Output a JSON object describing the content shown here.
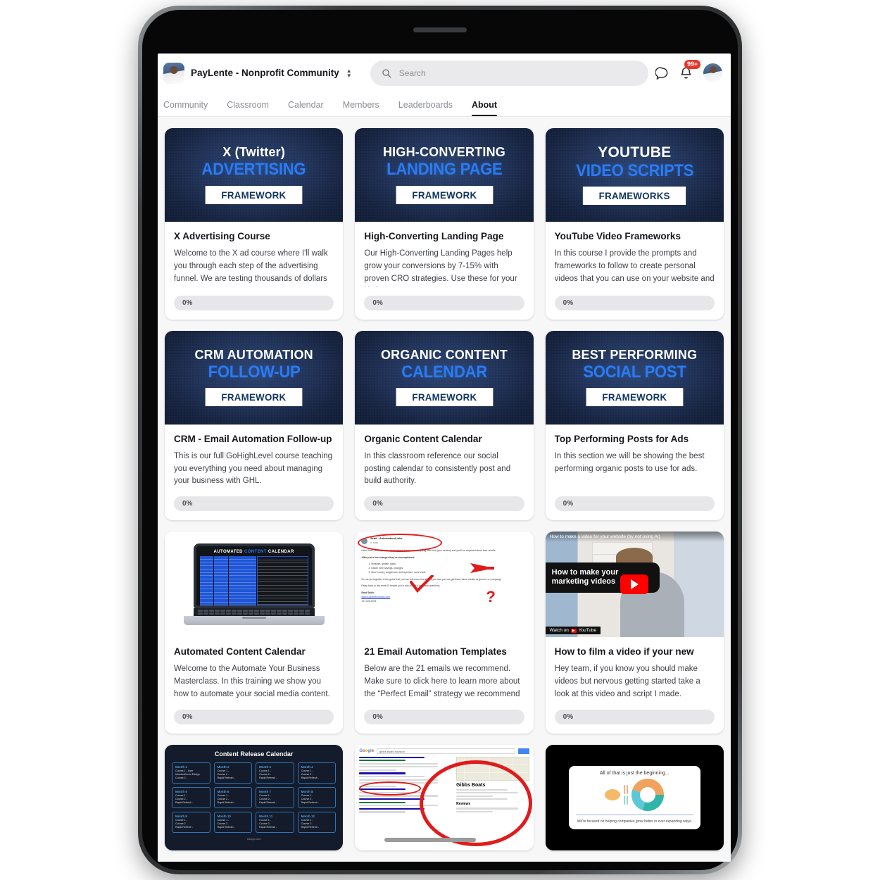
{
  "header": {
    "brand_title": "PayLente - Nonprofit Community",
    "brand_avatar_icon": "user-avatar-image",
    "switcher_icon": "chevron-up-down-icon",
    "search": {
      "icon": "search-icon",
      "placeholder": "Search",
      "value": ""
    },
    "chat_icon": "chat-bubble-icon",
    "bell_icon": "bell-icon",
    "notification_badge": "99+",
    "profile_icon": "profile-avatar"
  },
  "nav": {
    "tabs": [
      {
        "label": "Community",
        "active": false
      },
      {
        "label": "Classroom",
        "active": false
      },
      {
        "label": "Calendar",
        "active": false
      },
      {
        "label": "Members",
        "active": false
      },
      {
        "label": "Leaderboards",
        "active": false
      },
      {
        "label": "About",
        "active": true
      }
    ]
  },
  "courses": {
    "row1": [
      {
        "banner": {
          "line1": "X (Twitter)",
          "line2": "ADVERTISING",
          "chip": "FRAMEWORK"
        },
        "title": "X Advertising Course",
        "description": "Welcome to the X ad course where I'll walk you through each step of the advertising funnel. We are testing thousands of dollars",
        "progress": "0%"
      },
      {
        "banner": {
          "line1": "HIGH-CONVERTING",
          "line2": "LANDING PAGE",
          "chip": "FRAMEWORK"
        },
        "title": "High-Converting Landing Page",
        "description": "Our High-Converting Landing Pages help grow your conversions by 7-15% with proven CRO strategies. Use these for your X shop",
        "progress": "0%"
      },
      {
        "banner": {
          "line1": "YOUTUBE",
          "line2": "VIDEO SCRIPTS",
          "chip": "FRAMEWORKS"
        },
        "title": "YouTube Video Frameworks",
        "description": "In this course I provide the prompts and frameworks to follow to create personal videos that you can use on your website and",
        "progress": "0%"
      }
    ],
    "row2": [
      {
        "banner": {
          "line1": "CRM AUTOMATION",
          "line2": "FOLLOW-UP",
          "chip": "FRAMEWORK"
        },
        "title": "CRM - Email Automation Follow-up",
        "description": "This is our full GoHighLevel course teaching you everything you need about managing your business with GHL.",
        "progress": "0%"
      },
      {
        "banner": {
          "line1": "ORGANIC CONTENT",
          "line2": "CALENDAR",
          "chip": "FRAMEWORK"
        },
        "title": "Organic Content Calendar",
        "description": "In this classroom reference our social posting calendar to consistently post and build authority.",
        "progress": "0%"
      },
      {
        "banner": {
          "line1": "BEST PERFORMING",
          "line2": "SOCIAL POST",
          "chip": "FRAMEWORK"
        },
        "title": "Top Performing Posts for Ads",
        "description": "In this section we will be showing the best performing organic posts to use for ads.",
        "progress": "0%"
      }
    ],
    "row3": [
      {
        "thumb_kind": "laptop-content-calendar",
        "thumb_text": {
          "title_a": "AUTOMATED",
          "title_b": "CONTENT",
          "title_c": "CALENDAR"
        },
        "title": "Automated Content Calendar",
        "description": "Welcome to the Automate Your Business Masterclass. In this training we show you how to automate your social media content.",
        "progress": "0%"
      },
      {
        "thumb_kind": "email-screenshot",
        "thumb_text": {
          "sender": "Brad - AutomationLinks",
          "to": "to brad",
          "p1": "Hello there, recently we've been helping [person or company] with their [your service] and you'll be surprised about their results.",
          "p2": "After just a few changes they've accomplished:",
          "li1": "increase, growth, sales",
          "li2": "Easier, time savings, changes",
          "li3": "More money, weight loss, feeling better, more leads",
          "p3": "So, we put together a free guide that you can reference that shows you how you can get these same results as [person or company].",
          "p4": "Reply back to this email I'll helped you in any way or if you have questions.",
          "sign": "Brad Smith",
          "link": "www.AutomationLinks.com",
          "phone": "727-222-1676"
        },
        "title": "21 Email Automation Templates",
        "description": "Below are the 21 emails we recommend. Make sure to click here to learn more about the “Perfect Email” strategy we recommend",
        "progress": "0%"
      },
      {
        "thumb_kind": "youtube-video",
        "thumb_text": {
          "video_title": "How to make a video for your website (by not using AI)",
          "overlay": "How to make your marketing videos",
          "watch_on": "Watch on",
          "brand": "YouTube",
          "play_icon": "play-button-icon"
        },
        "title": "How to film a video if your new",
        "description": "Hey team, if you know you should make videos but nervous getting started take a look at this video and script I made.",
        "progress": "0%"
      }
    ],
    "row4": [
      {
        "thumb_kind": "content-release-calendar",
        "thumb_text": {
          "title": "Content Release Calendar",
          "footer": "edapp.com",
          "months": [
            {
              "m": "Month 1",
              "lines": [
                "Course 1 - User Introduction to EdApp",
                "Course 2 -"
              ]
            },
            {
              "m": "Month 2",
              "lines": [
                "Course 1 -",
                "Course 2 -",
                "Rapid Refresh -"
              ]
            },
            {
              "m": "Month 3",
              "lines": [
                "Course 1 -",
                "Course 2 -",
                "Rapid Refresh -"
              ]
            },
            {
              "m": "Month 4",
              "lines": [
                "Course 1 -",
                "Course 2 -",
                "Rapid Refresh -"
              ]
            },
            {
              "m": "Month 5",
              "lines": [
                "Course 1 -",
                "Course 2 -",
                "Rapid Refresh -"
              ]
            },
            {
              "m": "Month 6",
              "lines": [
                "Course 1 -",
                "Course 2 -",
                "Rapid Refresh -"
              ]
            },
            {
              "m": "Month 7",
              "lines": [
                "Course 1 -",
                "Course 2 -",
                "Rapid Refresh -"
              ]
            },
            {
              "m": "Month 8",
              "lines": [
                "Course 1 -",
                "Course 2 -",
                "Rapid Refresh -"
              ]
            },
            {
              "m": "Month 9",
              "lines": [
                "Course 1 -",
                "Course 2 -",
                "Rapid Refresh -"
              ]
            },
            {
              "m": "Month 10",
              "lines": [
                "Course 1 -",
                "Course 2 -",
                "Rapid Refresh -"
              ]
            },
            {
              "m": "Month 11",
              "lines": [
                "Course 1 -",
                "Course 2 -",
                "Rapid Refresh -"
              ]
            },
            {
              "m": "Month 12",
              "lines": [
                "Course 1 -",
                "Course 2 -",
                "Rapid Refresh -"
              ]
            }
          ]
        }
      },
      {
        "thumb_kind": "google-serp",
        "thumb_text": {
          "query": "gibbs boats houston",
          "logo": "Google",
          "business": "Gibbs Boats",
          "label_reviews": "Reviews"
        }
      },
      {
        "thumb_kind": "presentation-slide",
        "thumb_text": {
          "title": "All of that is just the beginning...",
          "footer": "We're focused on helping companies grow better in ever expanding ways."
        }
      }
    ]
  },
  "colors": {
    "accent_blue": "#2b7bf3",
    "banner_navy": "#16233f",
    "badge_red": "#e8342a",
    "progress_track": "#e7e7e9",
    "page_bg": "#f7f7f8"
  }
}
